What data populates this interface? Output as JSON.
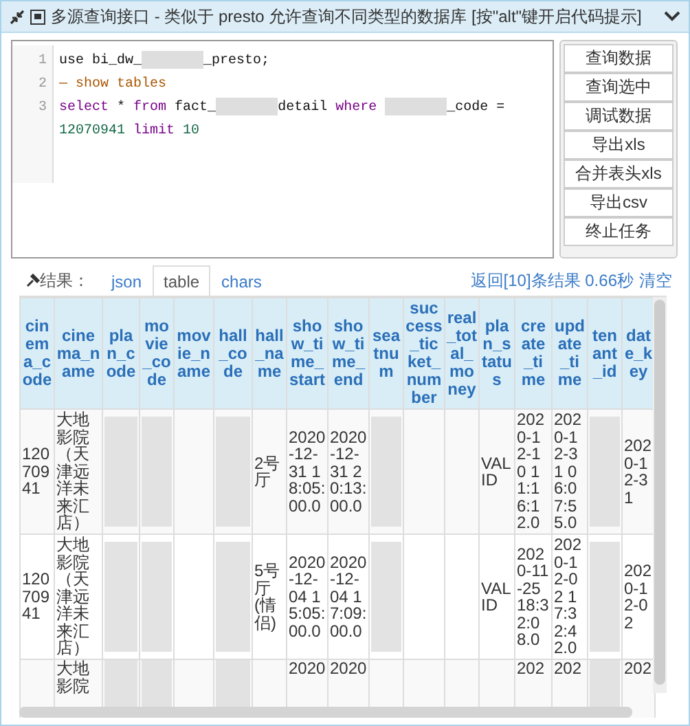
{
  "window": {
    "title": "多源查询接口 - 类似于 presto 允许查询不同类型的数据库 [按\"alt\"键开启代码提示]"
  },
  "editor": {
    "lines": [
      {
        "number": "1",
        "tokens": [
          {
            "kind": "plain",
            "text": "use bi_dw_"
          },
          {
            "kind": "redacted"
          },
          {
            "kind": "plain",
            "text": "_presto;"
          }
        ]
      },
      {
        "number": "2",
        "tokens": [
          {
            "kind": "comment",
            "text": "— show tables"
          }
        ]
      },
      {
        "number": "3",
        "tokens": [
          {
            "kind": "keyword",
            "text": "select"
          },
          {
            "kind": "plain",
            "text": " * "
          },
          {
            "kind": "keyword",
            "text": "from"
          },
          {
            "kind": "plain",
            "text": " fact_"
          },
          {
            "kind": "redacted"
          },
          {
            "kind": "plain",
            "text": "detail "
          },
          {
            "kind": "keyword",
            "text": "where "
          },
          {
            "kind": "redacted"
          },
          {
            "kind": "plain",
            "text": "_code = "
          },
          {
            "kind": "number",
            "text": "12070941 "
          },
          {
            "kind": "keyword",
            "text": "limit "
          },
          {
            "kind": "number",
            "text": "10"
          }
        ]
      }
    ]
  },
  "actions": [
    "查询数据",
    "查询选中",
    "调试数据",
    "导出xls",
    "合并表头xls",
    "导出csv",
    "终止任务"
  ],
  "results": {
    "label": "结果：",
    "tabs": [
      {
        "label": "json",
        "selected": false
      },
      {
        "label": "table",
        "selected": true
      },
      {
        "label": "chars",
        "selected": false
      }
    ],
    "summary": "返回[10]条结果 0.66秒",
    "clear": "清空"
  },
  "table": {
    "columns": [
      "cinema_code",
      "cinema_name",
      "plan_code",
      "movie_code",
      "movie_name",
      "hall_code",
      "hall_name",
      "show_time_start",
      "show_time_end",
      "seatnum",
      "success_ticket_number",
      "real_total_money",
      "plan_status",
      "create_time",
      "update_time",
      "tenant_id",
      "date_key"
    ],
    "rows": [
      [
        {
          "text": "12070941"
        },
        {
          "text": "大地影院（天津远洋未来汇店）"
        },
        {
          "redacted": true
        },
        {
          "redacted": true
        },
        {},
        {
          "redacted": true
        },
        {
          "text": "2号厅"
        },
        {
          "text": "2020-12-31 18:05:00.0"
        },
        {
          "text": "2020-12-31 20:13:00.0"
        },
        {
          "redacted": true
        },
        {},
        {},
        {
          "text": "VALID"
        },
        {
          "text": "2020-12-10 11:16:12.0"
        },
        {
          "text": "2020-12-31 06:07:55.0"
        },
        {
          "redacted": true
        },
        {
          "text": "2020-12-31"
        }
      ],
      [
        {
          "text": "12070941"
        },
        {
          "text": "大地影院（天津远洋未来汇店）"
        },
        {
          "redacted": true
        },
        {
          "redacted": true
        },
        {},
        {
          "redacted": true
        },
        {
          "text": "5号厅(情侣)"
        },
        {
          "text": "2020-12-04 15:05:00.0"
        },
        {
          "text": "2020-12-04 17:09:00.0"
        },
        {
          "redacted": true
        },
        {},
        {},
        {
          "text": "VALID"
        },
        {
          "text": "2020-11-25 18:32:08.0"
        },
        {
          "text": "2020-12-02 17:32:42.0"
        },
        {
          "redacted": true
        },
        {
          "text": "2020-12-02"
        }
      ],
      [
        {},
        {
          "text": "大地影院"
        },
        {
          "redacted": true
        },
        {
          "redacted": true
        },
        {},
        {
          "redacted": true
        },
        {},
        {
          "text": "2020"
        },
        {
          "text": "2020"
        },
        {},
        {},
        {},
        {},
        {
          "text": "202"
        },
        {
          "text": "202"
        },
        {
          "redacted": true
        },
        {
          "text": "202"
        }
      ]
    ]
  }
}
